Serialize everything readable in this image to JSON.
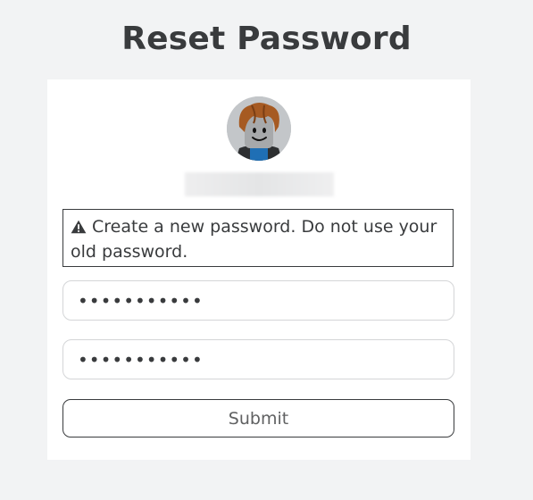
{
  "page": {
    "title": "Reset Password"
  },
  "alert": {
    "icon": "warning-icon",
    "message": "Create a new password. Do not use your old password."
  },
  "form": {
    "new_password_value": "•••••••••••",
    "confirm_password_value": "•••••••••••",
    "submit_label": "Submit"
  },
  "colors": {
    "background": "#f2f3f4",
    "card": "#ffffff",
    "text": "#393b3d",
    "field_border": "#d4d5d7"
  }
}
